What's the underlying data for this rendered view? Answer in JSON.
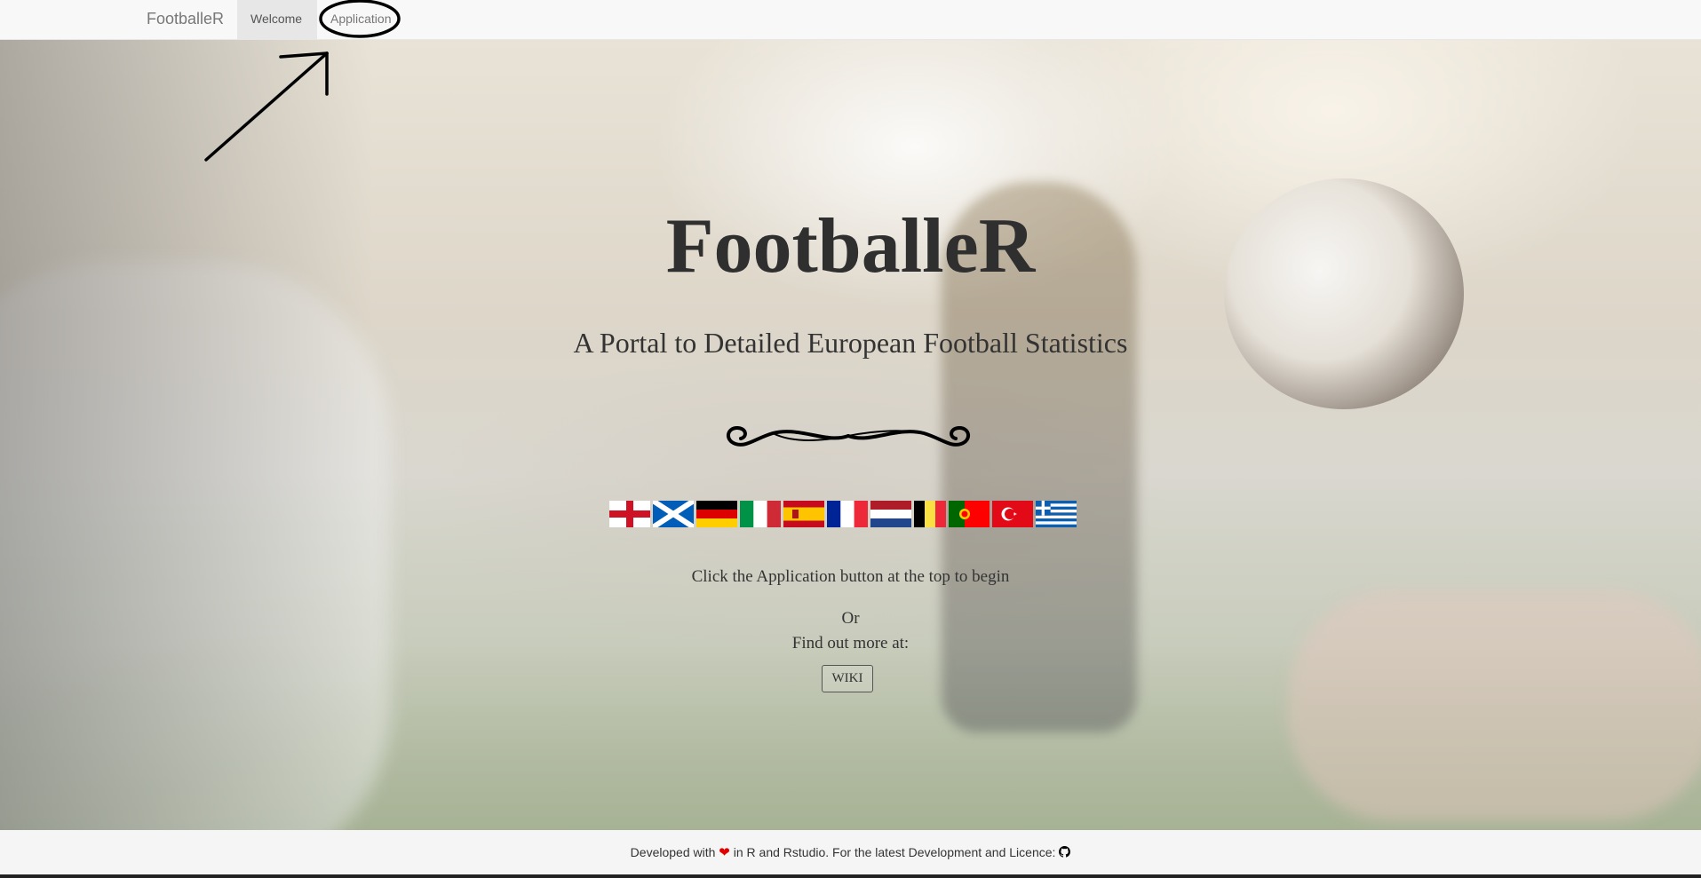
{
  "navbar": {
    "brand": "FootballeR",
    "tabs": [
      {
        "label": "Welcome",
        "active": true
      },
      {
        "label": "Application",
        "active": false
      }
    ]
  },
  "hero": {
    "title": "FootballeR",
    "subtitle": "A Portal to Detailed European Football Statistics",
    "flags": [
      "england-flag",
      "scotland-flag",
      "germany-flag",
      "italy-flag",
      "spain-flag",
      "france-flag",
      "netherlands-flag",
      "belgium-flag",
      "portugal-flag",
      "turkey-flag",
      "greece-flag"
    ],
    "prompt": "Click the Application button at the top to begin",
    "or": "Or",
    "findout": "Find out more at:",
    "wiki_label": "WIKI"
  },
  "footer": {
    "text_before": "Developed with",
    "text_after": "in R and Rstudio. For the latest Development and Licence:",
    "heart_icon": "heart-icon",
    "link_icon": "github-icon",
    "heart_color": "#e00000"
  },
  "colors": {
    "navbar_bg": "#f8f8f8",
    "active_tab_bg": "#e7e7e7",
    "footer_bg": "#f5f5f5",
    "title_color": "#2f2f2f"
  }
}
